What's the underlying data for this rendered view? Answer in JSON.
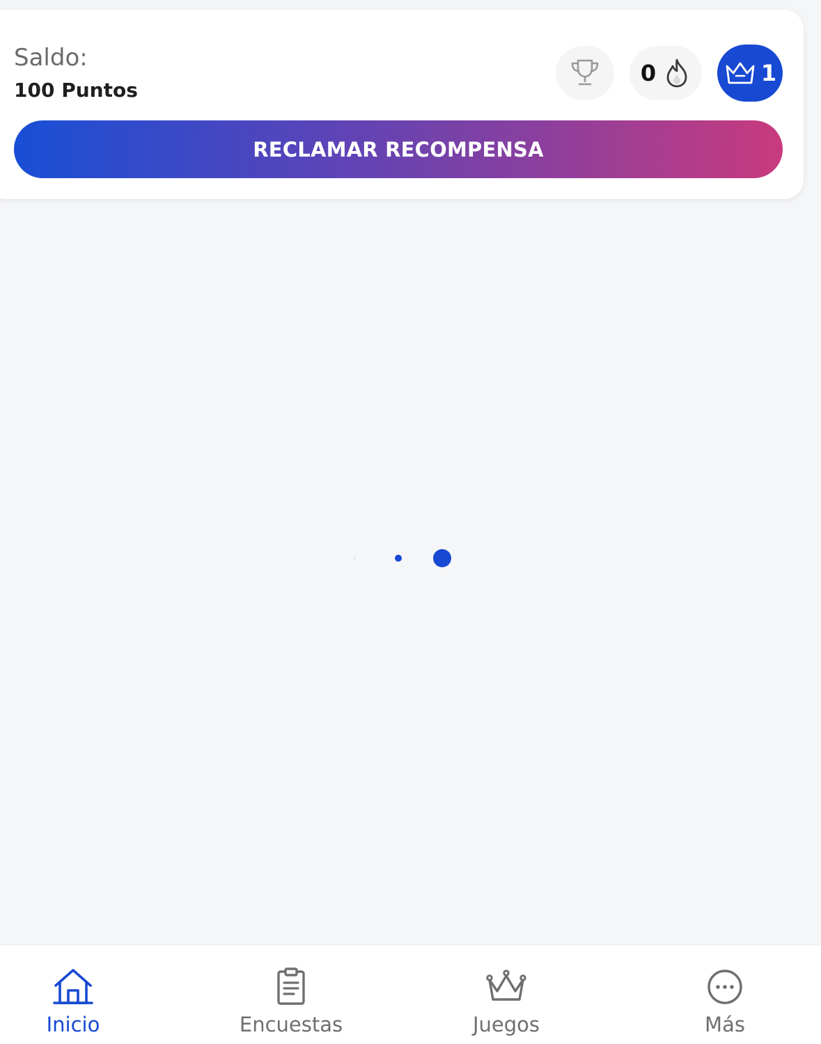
{
  "header": {
    "balance_label": "Saldo:",
    "balance_value": "100 Puntos",
    "trophy_icon": "trophy-icon",
    "streak": {
      "count": "0",
      "icon": "flame-icon"
    },
    "level": {
      "count": "1",
      "icon": "crown-icon",
      "color": "#1749d3"
    },
    "claim_button_label": "RECLAMAR RECOMPENSA"
  },
  "loader": {
    "color": "#1749d3"
  },
  "bottom_nav": {
    "items": [
      {
        "label": "Inicio",
        "icon": "home-icon",
        "active": true
      },
      {
        "label": "Encuestas",
        "icon": "clipboard-icon",
        "active": false
      },
      {
        "label": "Juegos",
        "icon": "crown-icon",
        "active": false
      },
      {
        "label": "Más",
        "icon": "more-icon",
        "active": false
      }
    ],
    "active_color": "#1749d3",
    "inactive_color": "#6f6f6f"
  }
}
